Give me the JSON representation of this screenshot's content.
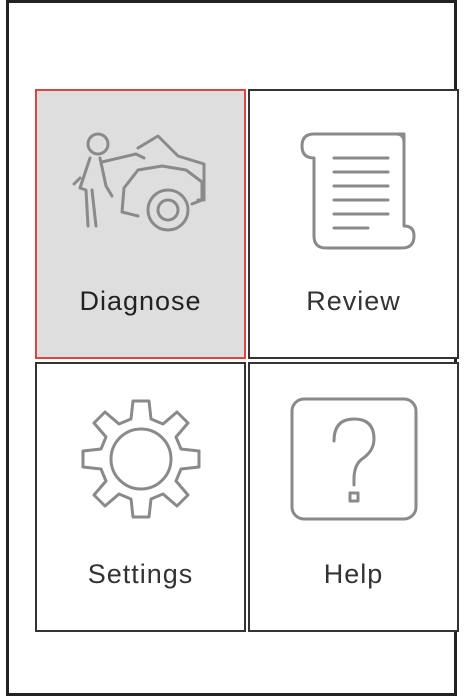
{
  "menu": {
    "items": [
      {
        "label": "Diagnose",
        "icon": "mechanic-car-icon",
        "selected": true
      },
      {
        "label": "Review",
        "icon": "scroll-document-icon",
        "selected": false
      },
      {
        "label": "Settings",
        "icon": "gear-icon",
        "selected": false
      },
      {
        "label": "Help",
        "icon": "question-mark-icon",
        "selected": false
      }
    ]
  },
  "colors": {
    "selected_border": "#e04545",
    "selected_background": "#dedede",
    "tile_border": "#333333",
    "icon_stroke": "#8a8a8a"
  }
}
